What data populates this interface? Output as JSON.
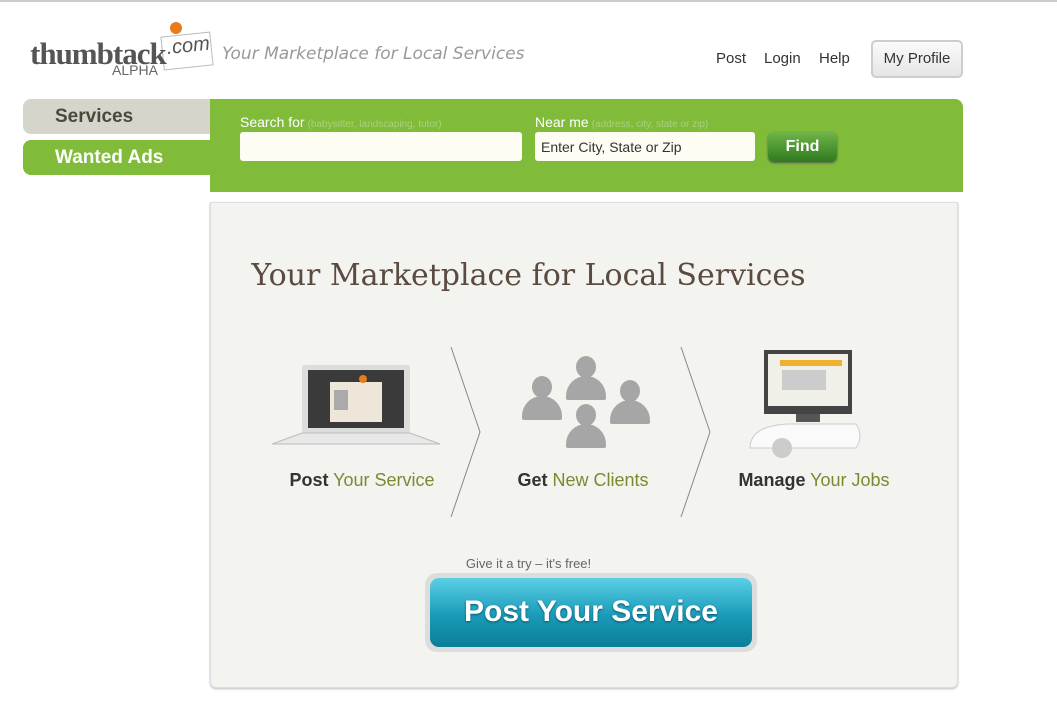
{
  "header": {
    "logo_text": "thumbtack",
    "logo_com": ".com",
    "logo_badge": "ALPHA",
    "tagline": "Your Marketplace for Local Services",
    "links": [
      "Post",
      "Login",
      "Help"
    ],
    "profile_button": "My Profile"
  },
  "tabs": [
    {
      "label": "Services",
      "active": true
    },
    {
      "label": "Wanted Ads",
      "active": false
    }
  ],
  "search": {
    "search_label": "Search for",
    "search_hint": "(babysitter, landscaping, tutor)",
    "search_value": "",
    "near_label": "Near me",
    "near_hint": "(address, city, state or zip)",
    "near_value": "Enter City, State or Zip",
    "find_button": "Find"
  },
  "main": {
    "heading": "Your Marketplace for Local Services",
    "steps": [
      {
        "bold": "Post",
        "rest": "Your Service",
        "icon": "laptop-icon"
      },
      {
        "bold": "Get",
        "rest": "New Clients",
        "icon": "people-icon"
      },
      {
        "bold": "Manage",
        "rest": "Your Jobs",
        "icon": "computer-icon"
      }
    ],
    "cta_note": "Give it a try – it's free!",
    "cta_button": "Post Your Service"
  },
  "colors": {
    "green": "#80bc3a",
    "cta": "#1a9ab8",
    "heading": "#5a4a40"
  }
}
